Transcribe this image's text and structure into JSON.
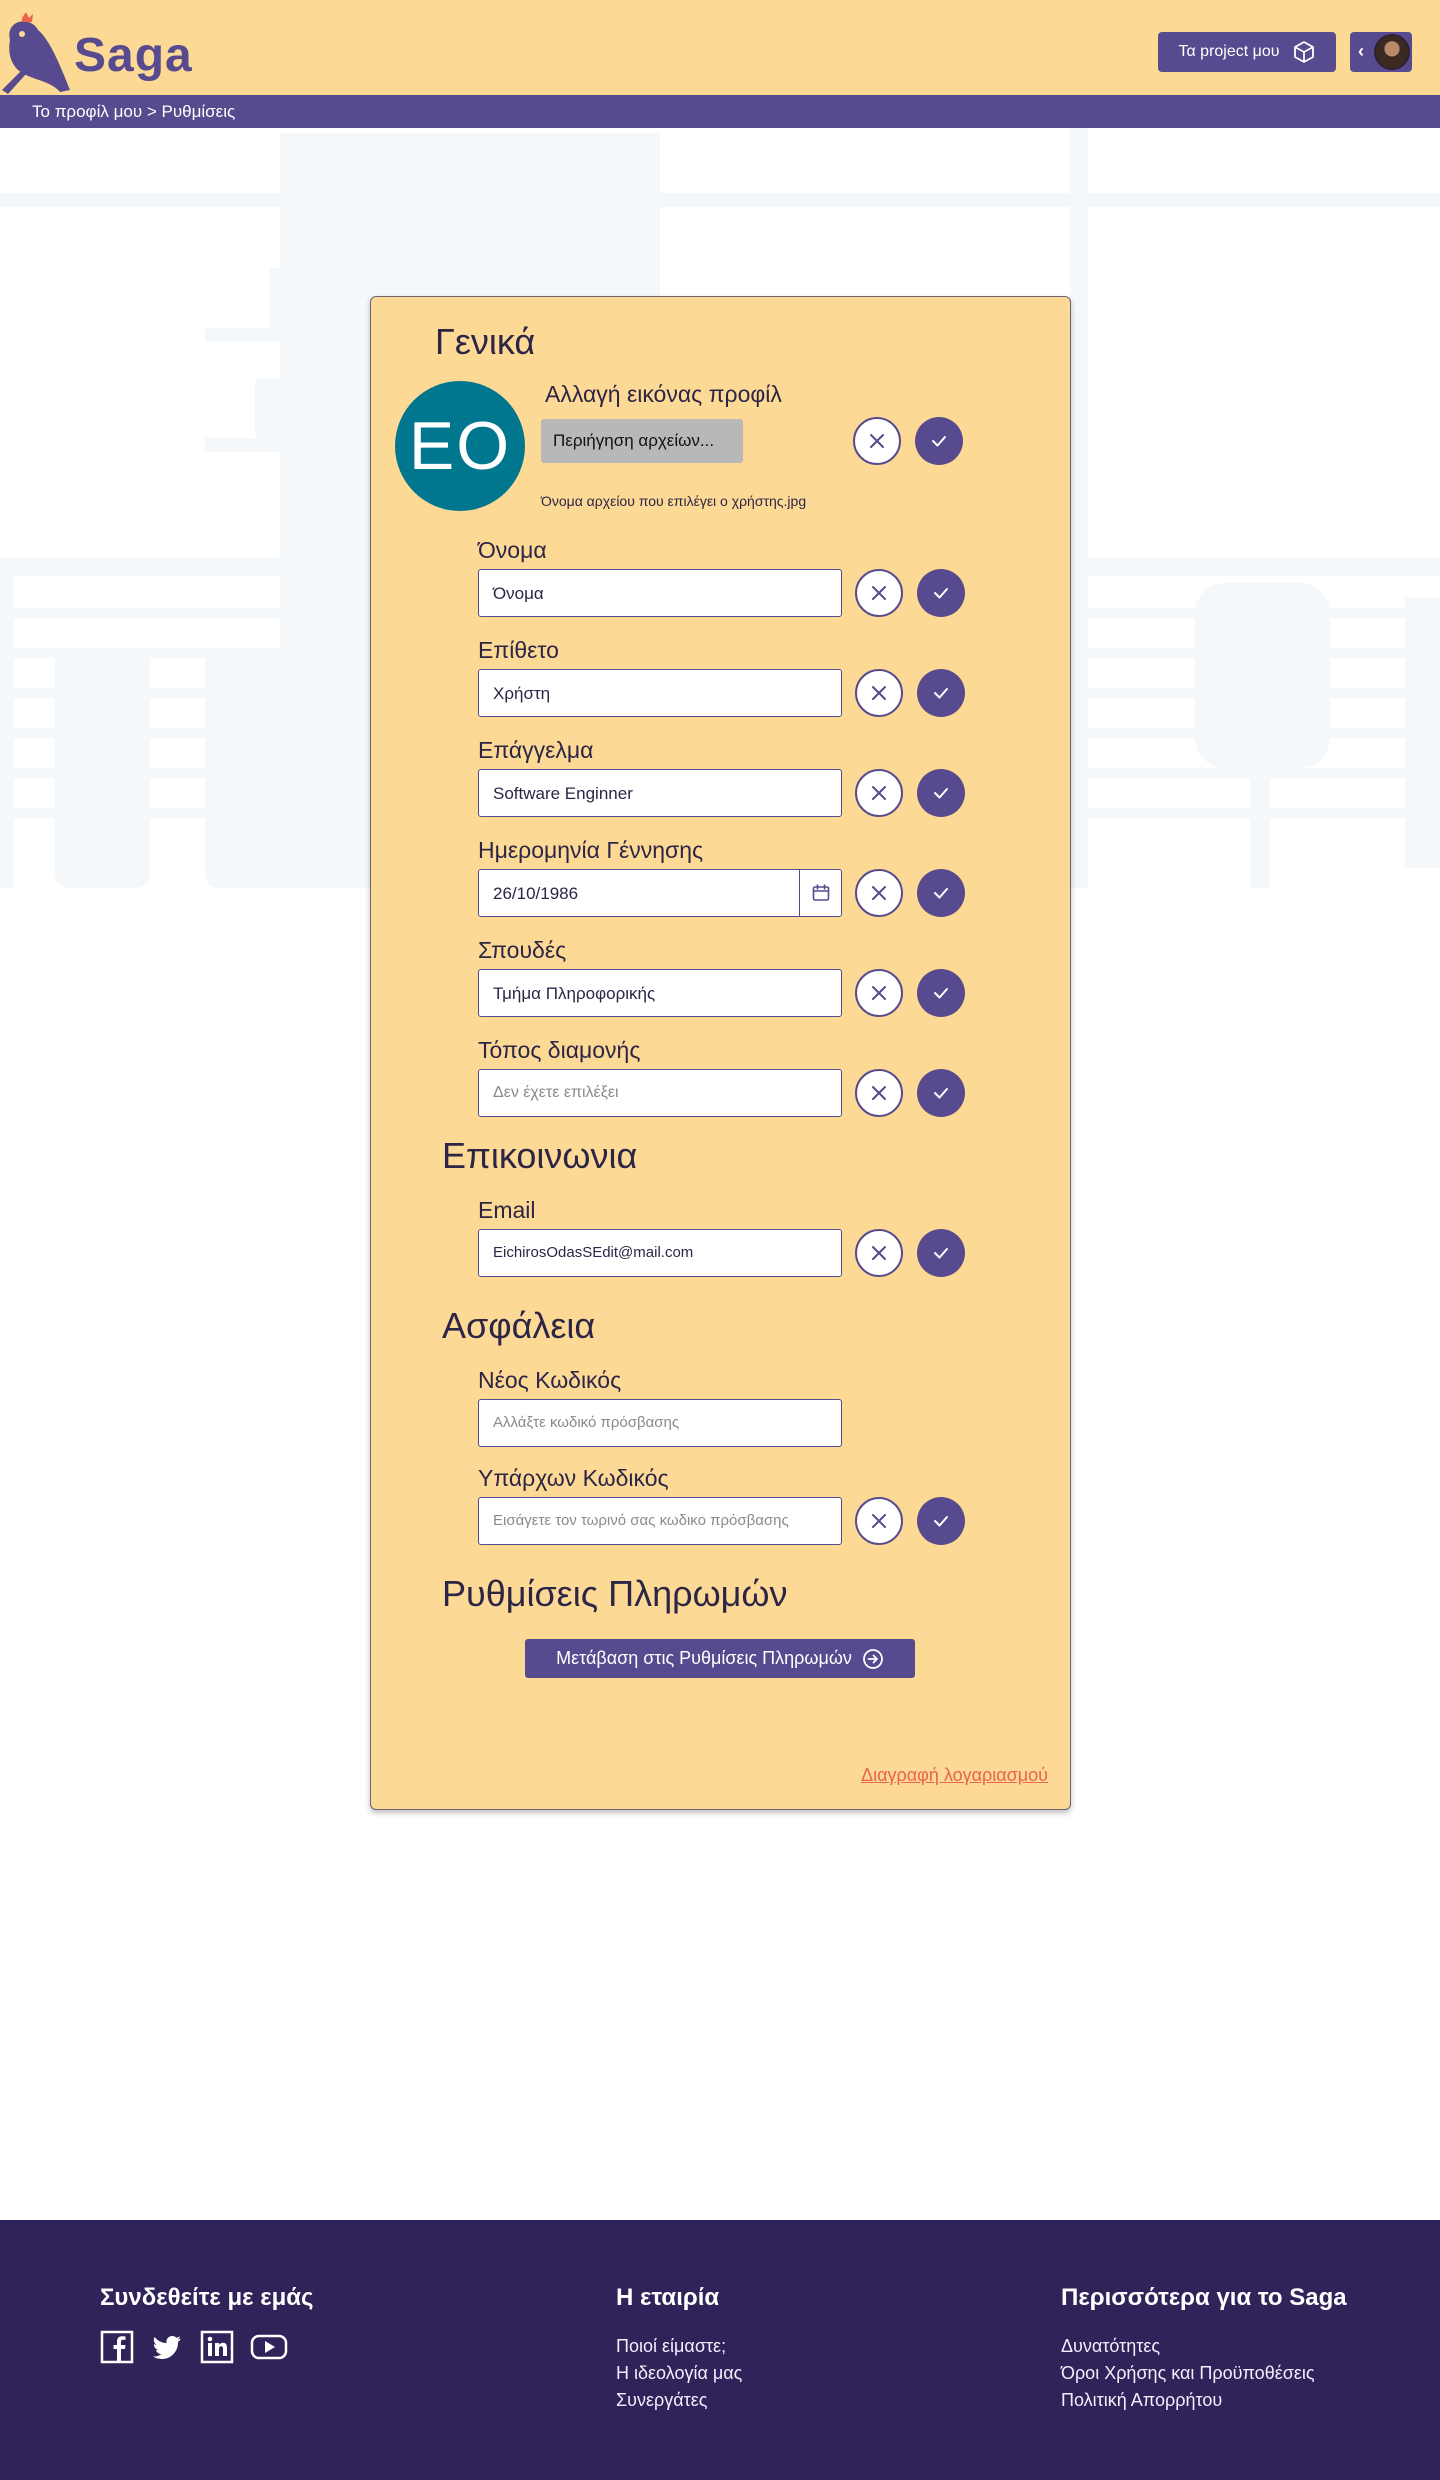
{
  "header": {
    "logo_text": "Saga",
    "projects_button": "Τα project μου",
    "user_avatar": "user-avatar"
  },
  "breadcrumb": "Το προφίλ μου > Ρυθμίσεις",
  "general": {
    "title": "Γενικά",
    "avatar_initials": "EO",
    "change_picture_label": "Αλλαγή εικόνας προφίλ",
    "browse_button": "Περιήγηση αρχείων...",
    "file_name": "Όνομα αρχείου που επιλέγει ο χρήστης.jpg",
    "fields": [
      {
        "label": "Όνομα",
        "value": "Όνομα",
        "placeholder": false
      },
      {
        "label": "Επίθετο",
        "value": "Χρήστη",
        "placeholder": false
      },
      {
        "label": "Επάγγελμα",
        "value": "Software Enginner",
        "placeholder": false
      },
      {
        "label": "Ημερομηνία Γέννησης",
        "value": "26/10/1986",
        "placeholder": false
      },
      {
        "label": "Σπουδές",
        "value": "Τμήμα Πληροφορικής",
        "placeholder": false
      },
      {
        "label": "Τόπος διαμονής",
        "value": "Δεν έχετε επιλέξει",
        "placeholder": true
      }
    ]
  },
  "contact": {
    "title": "Επικοινωνια",
    "email_label": "Email",
    "email_value": "EichirosOdasSEdit@mail.com"
  },
  "security": {
    "title": "Ασφάλεια",
    "new_password_label": "Νέος Κωδικός",
    "new_password_placeholder": "Αλλάξτε κωδικό πρόσβασης",
    "current_password_label": "Υπάρχων Κωδικός",
    "current_password_placeholder": "Εισάγετε τον τωρινό σας κωδικο πρόσβασης"
  },
  "payments": {
    "title": "Ρυθμίσεις Πληρωμών",
    "button": "Μετάβαση στις Ρυθμίσεις Πληρωμών"
  },
  "delete_account": "Διαγραφή λογαριασμού",
  "footer": {
    "connect_title": "Συνδεθείτε με εμάς",
    "company_title": "Η εταιρία",
    "company_links": [
      "Ποιοί είμαστε;",
      "Η ιδεολογία μας",
      "Συνεργάτες"
    ],
    "more_title": "Περισσότερα για το Saga",
    "more_links": [
      "Δυνατότητες",
      "Όροι Χρήσης και Προϋποθέσεις",
      "Πολιτική Απορρήτου"
    ],
    "social_icons": [
      "facebook-icon",
      "twitter-icon",
      "linkedin-icon",
      "youtube-icon"
    ]
  },
  "colors": {
    "primary": "#574a8e",
    "header_bg": "#fdd996",
    "footer_bg": "#2f2359",
    "avatar_bg": "#00768f",
    "danger": "#e8644a"
  }
}
